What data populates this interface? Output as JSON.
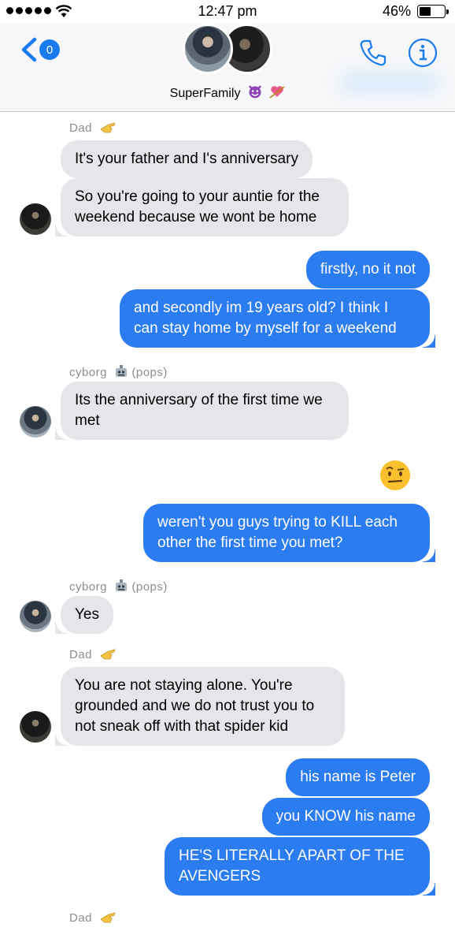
{
  "status_bar": {
    "time": "12:47 pm",
    "battery": "46%",
    "battery_level": 0.46
  },
  "header": {
    "back_badge": "0",
    "group_name": "SuperFamily",
    "group_name_emojis": [
      "smiling-devil",
      "heart-with-arrow"
    ]
  },
  "colors": {
    "accent": "#1a7bf0",
    "outgoing_bubble": "#2b7bf1",
    "incoming_bubble": "#e5e5ea",
    "sender_label": "#8e8e93"
  },
  "messages": [
    {
      "sender": "Dad",
      "sender_emoji": "pointing-hand",
      "text": "It's your father and I's anniversary",
      "direction": "incoming"
    },
    {
      "text": "So you're going to your auntie for the weekend because we wont be home",
      "direction": "incoming"
    },
    {
      "text": "firstly, no it not",
      "direction": "outgoing"
    },
    {
      "text": "and secondly im 19 years old? I think I can stay home by myself for a weekend",
      "direction": "outgoing"
    },
    {
      "sender": "cyborg",
      "sender_emoji": "robot",
      "sender_suffix": "(pops)",
      "text": "Its the anniversary of the first time we met",
      "direction": "incoming"
    },
    {
      "emoji": "face-with-raised-eyebrow",
      "direction": "outgoing"
    },
    {
      "text": "weren't you guys trying to KILL each other the first time you met?",
      "direction": "outgoing"
    },
    {
      "sender": "cyborg",
      "sender_emoji": "robot",
      "sender_suffix": "(pops)",
      "text": "Yes",
      "direction": "incoming"
    },
    {
      "sender": "Dad",
      "sender_emoji": "pointing-hand",
      "text": "You are not staying alone. You're grounded and we do not trust you to not sneak off with that spider kid",
      "direction": "incoming"
    },
    {
      "text": "his name is Peter",
      "direction": "outgoing"
    },
    {
      "text": "you KNOW his name",
      "direction": "outgoing"
    },
    {
      "text": "HE'S LITERALLY APART OF THE AVENGERS",
      "direction": "outgoing"
    },
    {
      "sender": "Dad",
      "sender_emoji": "pointing-hand",
      "direction": "incoming"
    }
  ]
}
